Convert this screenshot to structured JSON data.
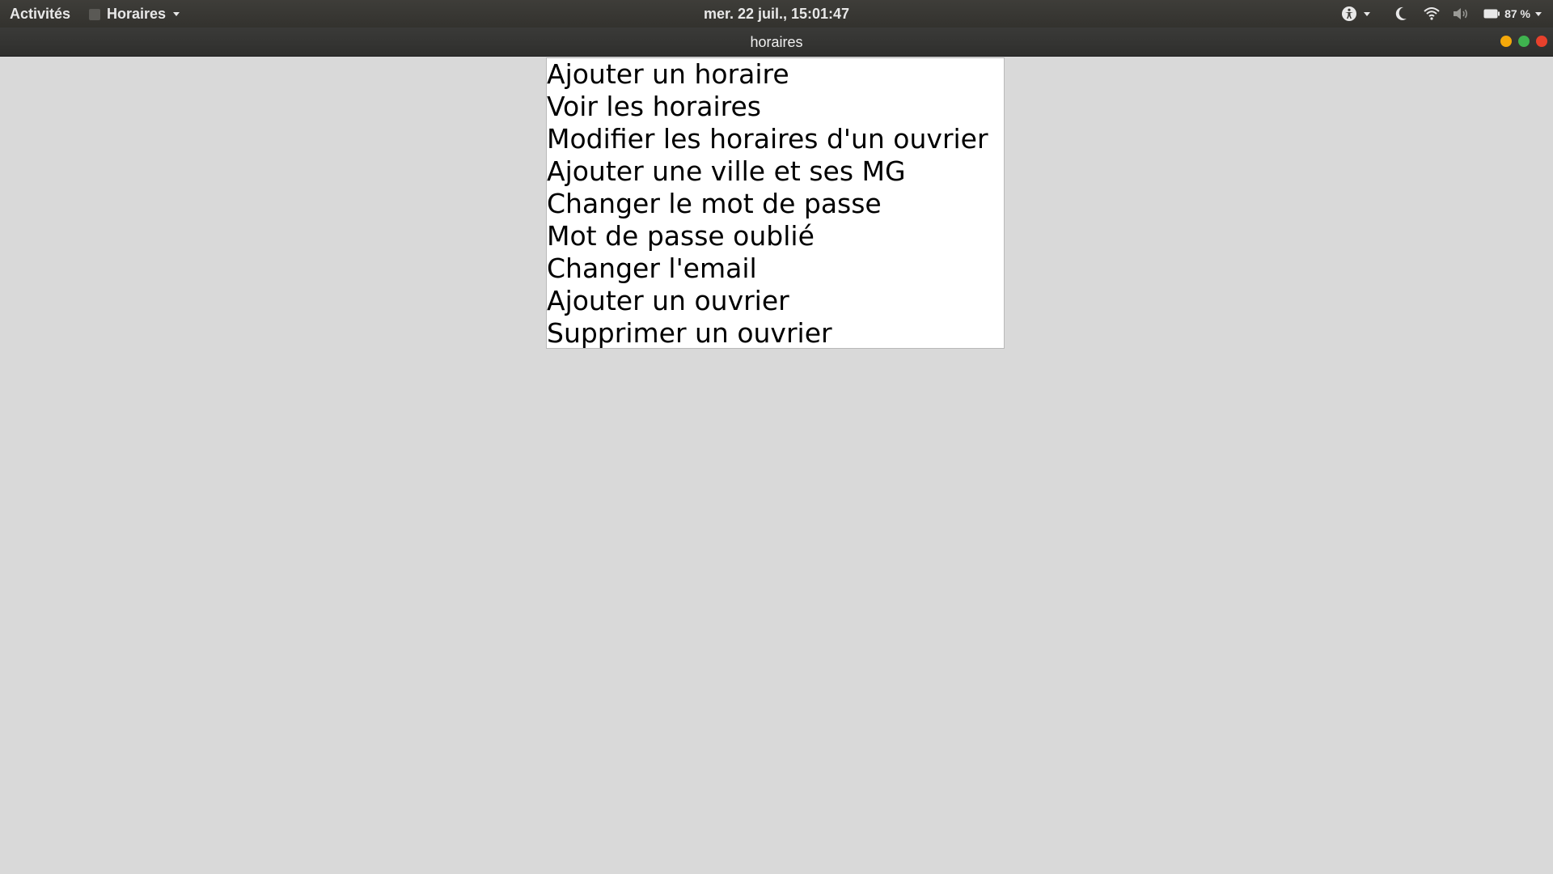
{
  "topbar": {
    "activities": "Activités",
    "app_menu": "Horaires",
    "clock": "mer. 22 juil., 15:01:47",
    "battery": "87 %"
  },
  "window": {
    "title": "horaires",
    "buttons": {
      "minimize_color": "#f4a80a",
      "maximize_color": "#3fb34f",
      "close_color": "#e8412c"
    }
  },
  "menu": {
    "items": [
      {
        "label": "Ajouter un horaire"
      },
      {
        "label": "Voir les horaires"
      },
      {
        "label": "Modifier les horaires d'un ouvrier"
      },
      {
        "label": "Ajouter une ville et ses MG"
      },
      {
        "label": "Changer le mot de passe"
      },
      {
        "label": "Mot de passe oublié"
      },
      {
        "label": "Changer l'email"
      },
      {
        "label": "Ajouter un ouvrier"
      },
      {
        "label": "Supprimer un ouvrier"
      }
    ]
  },
  "icons": {
    "accessibility": "accessibility-icon",
    "night_light": "moon-icon",
    "wifi": "wifi-icon",
    "volume": "volume-icon",
    "battery": "battery-icon"
  }
}
